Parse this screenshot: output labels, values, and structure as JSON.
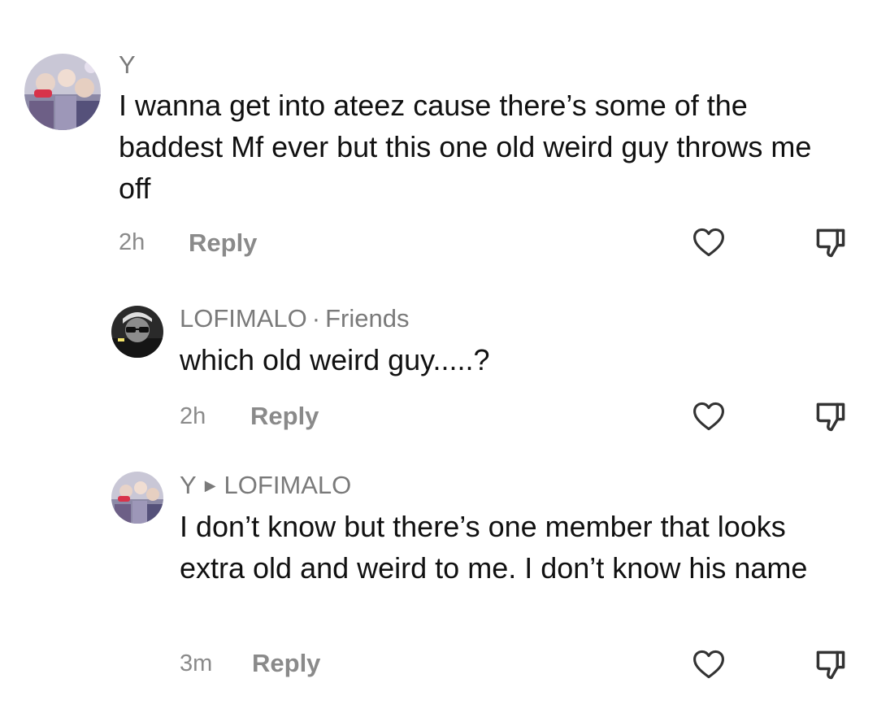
{
  "comments": [
    {
      "username": "Y",
      "text": "I wanna get into ateez cause there’s some of the baddest Mf ever but this one old weird guy throws me off",
      "time": "2h",
      "reply_label": "Reply",
      "like_icon": "heart-outline-icon",
      "dislike_icon": "thumbs-down-icon"
    },
    {
      "username": "LOFIMALO",
      "separator": "·",
      "relation": "Friends",
      "text": "which old weird guy.....?",
      "time": "2h",
      "reply_label": "Reply",
      "like_icon": "heart-outline-icon",
      "dislike_icon": "thumbs-down-icon"
    },
    {
      "username": "Y",
      "reply_to": "LOFIMALO",
      "text": "I don’t know but there’s one member that looks extra old and weird to me. I don’t know his name",
      "time": "3m",
      "reply_label": "Reply",
      "like_icon": "heart-outline-icon",
      "dislike_icon": "thumbs-down-icon"
    }
  ],
  "colors": {
    "text": "#111111",
    "muted": "#8a8a8a",
    "icon": "#333333",
    "background": "#ffffff"
  }
}
